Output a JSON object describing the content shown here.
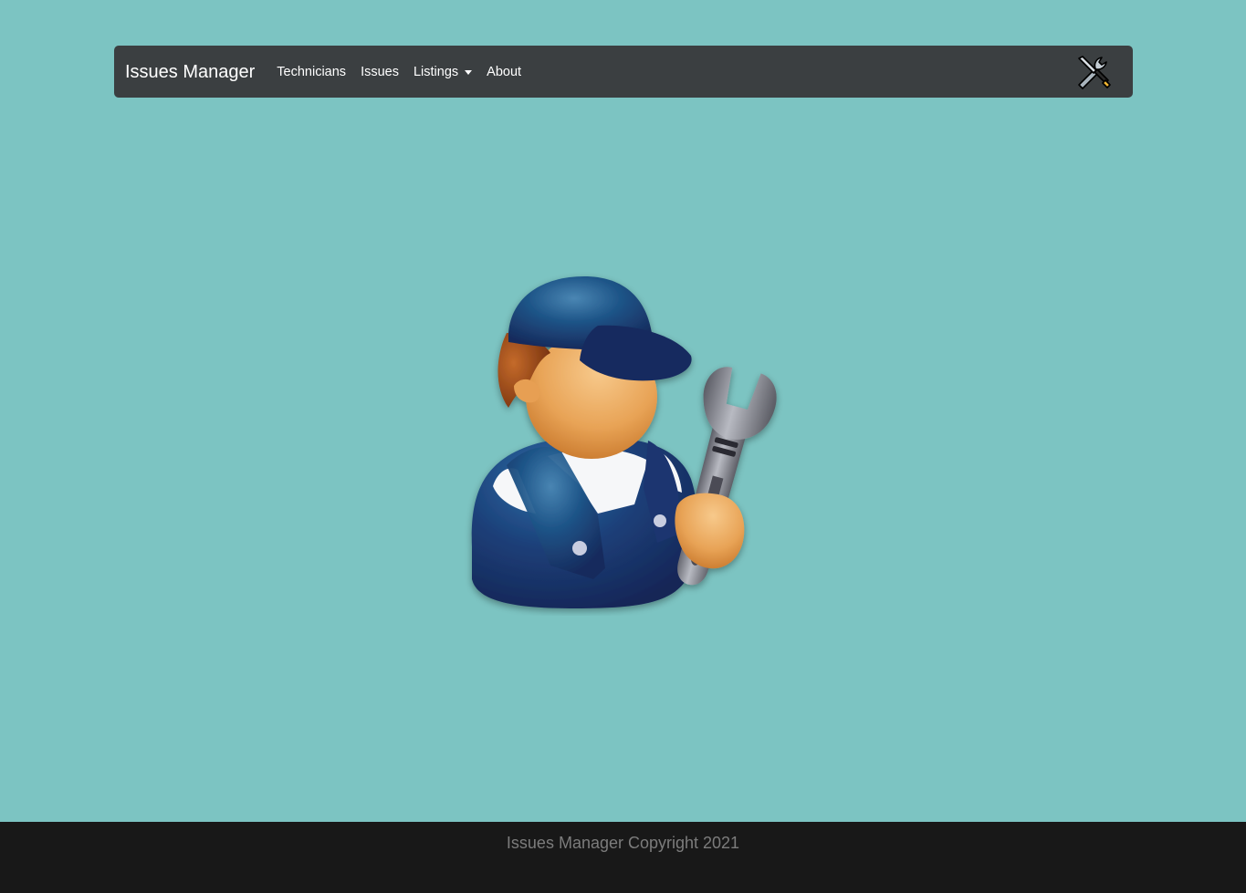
{
  "navbar": {
    "brand": "Issues Manager",
    "links": [
      {
        "label": "Technicians"
      },
      {
        "label": "Issues"
      },
      {
        "label": "Listings",
        "dropdown": true
      },
      {
        "label": "About"
      }
    ],
    "right_icon": "tools-icon"
  },
  "hero": {
    "image_icon": "technician-with-wrench-icon"
  },
  "footer": {
    "text": "Issues Manager Copyright 2021"
  },
  "colors": {
    "page_background": "#7cc4c2",
    "navbar_background": "#3b3f41",
    "footer_background": "#181818",
    "footer_text": "#7c7c7c"
  }
}
